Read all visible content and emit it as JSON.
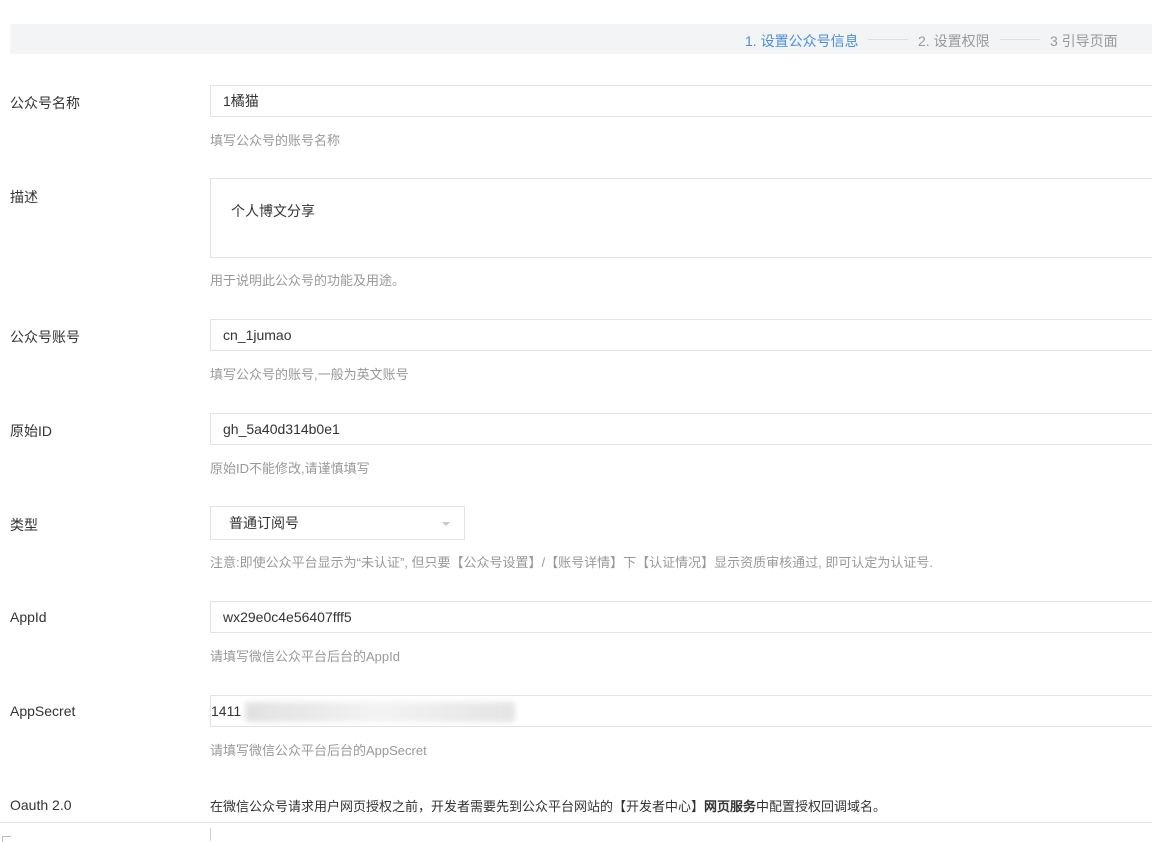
{
  "steps": [
    {
      "label": "1. 设置公众号信息"
    },
    {
      "label": "2. 设置权限"
    },
    {
      "label": "3 引导页面"
    }
  ],
  "form": {
    "name": {
      "label": "公众号名称",
      "value": "1橘猫",
      "hint": "填写公众号的账号名称"
    },
    "description": {
      "label": "描述",
      "value": "个人博文分享",
      "hint": "用于说明此公众号的功能及用途。"
    },
    "account": {
      "label": "公众号账号",
      "value": "cn_1jumao",
      "hint": "填写公众号的账号,一般为英文账号"
    },
    "original_id": {
      "label": "原始ID",
      "value": "gh_5a40d314b0e1",
      "hint": "原始ID不能修改,请谨慎填写"
    },
    "type": {
      "label": "类型",
      "value": "普通订阅号",
      "hint": "注意:即使公众平台显示为“未认证”, 但只要【公众号设置】/【账号详情】下【认证情况】显示资质审核通过, 即可认定为认证号."
    },
    "appid": {
      "label": "AppId",
      "value": "wx29e0c4e56407fff5",
      "hint": "请填写微信公众平台后台的AppId"
    },
    "appsecret": {
      "label": "AppSecret",
      "value_prefix": "1411",
      "hint": "请填写微信公众平台后台的AppSecret"
    },
    "oauth": {
      "label": "Oauth 2.0",
      "text_before": "在微信公众号请求用户网页授权之前，开发者需要先到公众平台网站的【开发者中心】",
      "text_bold": "网页服务",
      "text_after": "中配置授权回调域名。"
    }
  },
  "colors": {
    "accent": "#4a8ed8",
    "hint": "#999999",
    "border": "#e3e3e3"
  }
}
